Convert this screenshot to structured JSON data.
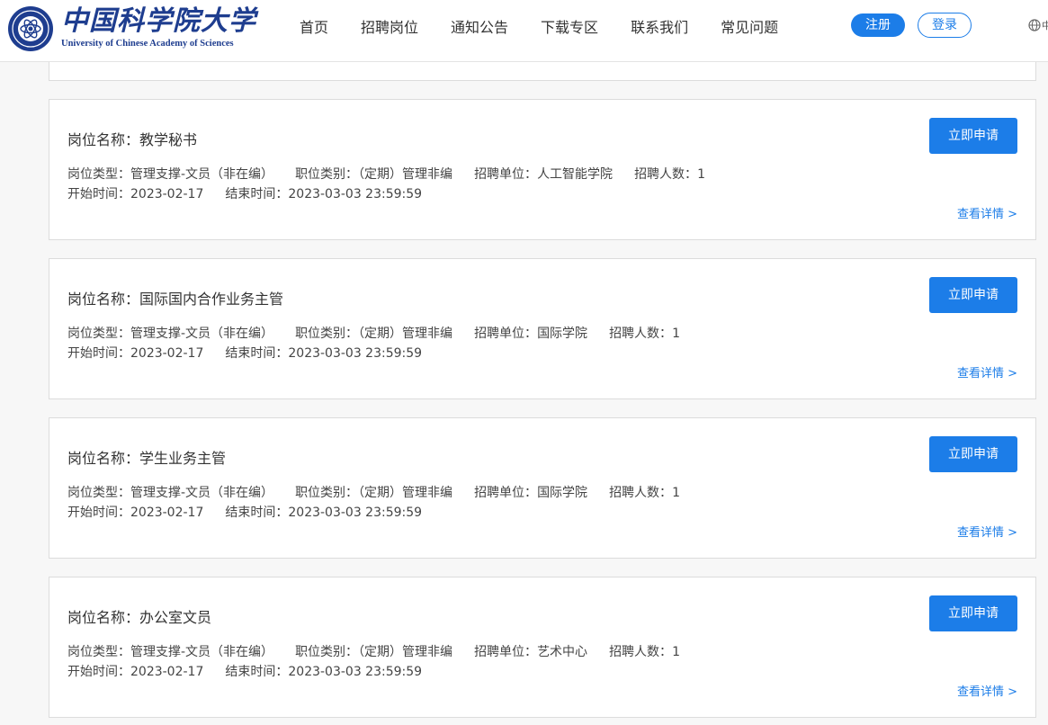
{
  "header": {
    "logo_cn": "中国科学院大学",
    "logo_en": "University of  Chinese Academy of Sciences",
    "nav": [
      "首页",
      "招聘岗位",
      "通知公告",
      "下载专区",
      "联系我们",
      "常见问题"
    ],
    "register_label": "注册",
    "login_label": "登录",
    "lang_label": "中"
  },
  "labels": {
    "name": "岗位名称：",
    "type": "岗位类型：",
    "category": "职位类别：",
    "unit": "招聘单位：",
    "count": "招聘人数：",
    "start": "开始时间：",
    "end": "结束时间：",
    "apply": "立即申请",
    "detail": "查看详情 >"
  },
  "jobs": [
    {
      "name": "教学秘书",
      "type": "管理支撑-文员（非在编）",
      "category": "（定期）管理非编",
      "unit": "人工智能学院",
      "count": "1",
      "start": "2023-02-17",
      "end": "2023-03-03 23:59:59"
    },
    {
      "name": "国际国内合作业务主管",
      "type": "管理支撑-文员（非在编）",
      "category": "（定期）管理非编",
      "unit": "国际学院",
      "count": "1",
      "start": "2023-02-17",
      "end": "2023-03-03 23:59:59"
    },
    {
      "name": "学生业务主管",
      "type": "管理支撑-文员（非在编）",
      "category": "（定期）管理非编",
      "unit": "国际学院",
      "count": "1",
      "start": "2023-02-17",
      "end": "2023-03-03 23:59:59"
    },
    {
      "name": "办公室文员",
      "type": "管理支撑-文员（非在编）",
      "category": "（定期）管理非编",
      "unit": "艺术中心",
      "count": "1",
      "start": "2023-02-17",
      "end": "2023-03-03 23:59:59"
    }
  ],
  "colors": {
    "brand": "#1e3d8f",
    "accent": "#1c7de8"
  }
}
